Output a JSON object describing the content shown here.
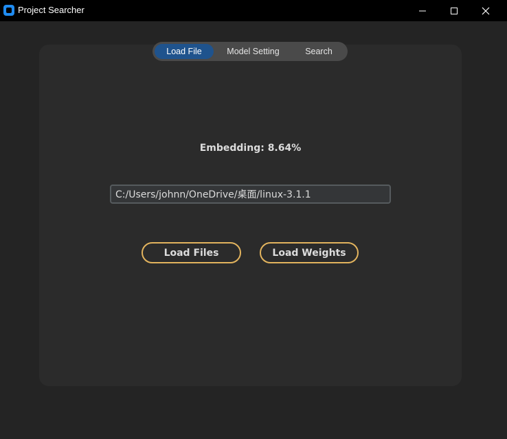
{
  "window": {
    "title": "Project Searcher",
    "controls": {
      "minimize": "─",
      "maximize": "☐",
      "close": "✕"
    }
  },
  "tabs": [
    {
      "label": "Load File",
      "selected": true
    },
    {
      "label": "Model Setting",
      "selected": false
    },
    {
      "label": "Search",
      "selected": false
    }
  ],
  "main": {
    "status_text": "Embedding: 8.64%",
    "path_value": "C:/Users/johnn/OneDrive/桌面/linux-3.1.1",
    "load_files_label": "Load Files",
    "load_weights_label": "Load Weights"
  },
  "colors": {
    "accent": "#1f538d",
    "button_border": "#e3b45e",
    "background": "#242424",
    "panel": "#2b2b2b"
  },
  "icons": {
    "app": "app-icon",
    "minimize": "minimize-icon",
    "maximize": "maximize-icon",
    "close": "close-icon"
  }
}
